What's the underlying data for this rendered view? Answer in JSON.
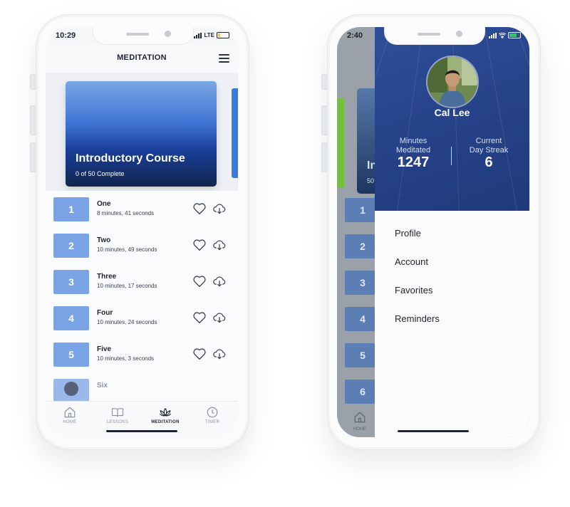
{
  "left_phone": {
    "status": {
      "time": "10:29",
      "network": "LTE"
    },
    "header": {
      "title": "MEDITATION"
    },
    "course": {
      "name": "Introductory Course",
      "progress": "0 of 50 Complete"
    },
    "lessons": [
      {
        "number": "1",
        "name": "One",
        "duration": "8 minutes, 41 seconds"
      },
      {
        "number": "2",
        "name": "Two",
        "duration": "10 minutes, 49 seconds"
      },
      {
        "number": "3",
        "name": "Three",
        "duration": "10 minutes, 17 seconds"
      },
      {
        "number": "4",
        "name": "Four",
        "duration": "10 minutes, 24 seconds"
      },
      {
        "number": "5",
        "name": "Five",
        "duration": "10 minutes, 3 seconds"
      },
      {
        "number": "",
        "name": "Six",
        "duration": ""
      }
    ],
    "tabs": [
      {
        "label": "HOME",
        "icon": "home-icon"
      },
      {
        "label": "LESSONS",
        "icon": "book-icon"
      },
      {
        "label": "MEDITATION",
        "icon": "lotus-icon",
        "active": true
      },
      {
        "label": "TIMER",
        "icon": "clock-icon"
      }
    ]
  },
  "right_phone": {
    "status": {
      "time": "2:40"
    },
    "profile": {
      "name": "Cal Lee"
    },
    "stats": [
      {
        "label_line1": "Minutes",
        "label_line2": "Meditated",
        "value": "1247"
      },
      {
        "label_line1": "Current",
        "label_line2": "Day Streak",
        "value": "6"
      }
    ],
    "menu": [
      "Profile",
      "Account",
      "Favorites",
      "Reminders"
    ],
    "behind": {
      "card_text": "In",
      "card_sub": "50",
      "numbers": [
        "1",
        "2",
        "3",
        "4",
        "5",
        "6"
      ],
      "tab_label": "HOME"
    }
  },
  "colors": {
    "accent": "#7aa3e6",
    "drawer": "#27438a",
    "text": "#1d2333"
  }
}
